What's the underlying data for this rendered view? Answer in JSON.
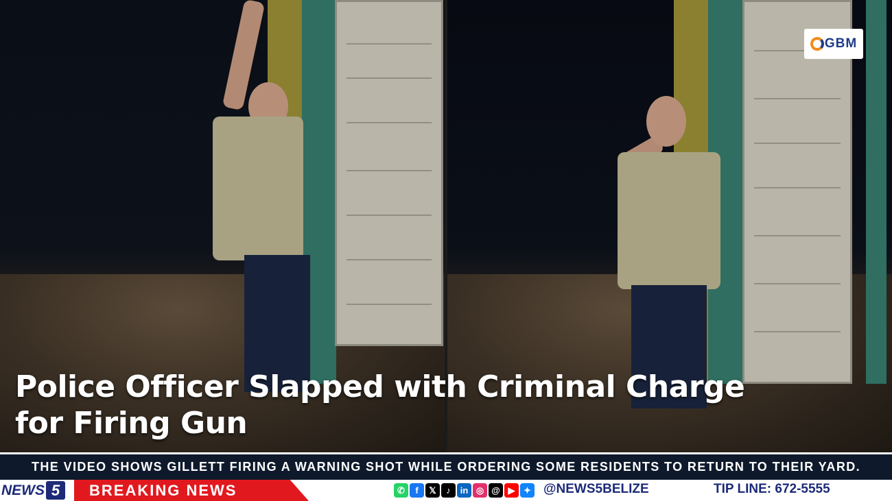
{
  "logo": {
    "text": "GBM"
  },
  "headline": {
    "line1": "Police Officer Slapped with Criminal Charge",
    "line2": "for Firing Gun"
  },
  "ticker": {
    "text": "THE VIDEO SHOWS GILLETT FIRING A WARNING SHOT WHILE ORDERING SOME RESIDENTS TO RETURN TO THEIR YARD."
  },
  "bottom_bar": {
    "brand_text": "NEWS",
    "brand_number": "5",
    "breaking_label": "BREAKING NEWS",
    "social_icons": [
      "whatsapp-icon",
      "facebook-icon",
      "x-icon",
      "tiktok-icon",
      "linkedin-icon",
      "instagram-icon",
      "threads-icon",
      "youtube-icon",
      "bluesky-icon"
    ],
    "social_handle": "@NEWS5BELIZE",
    "tip_line": "TIP LINE: 672-5555"
  },
  "colors": {
    "breaking_red": "#e1191f",
    "brand_blue": "#1d2a78",
    "ticker_bg": "#0e1a2c"
  }
}
